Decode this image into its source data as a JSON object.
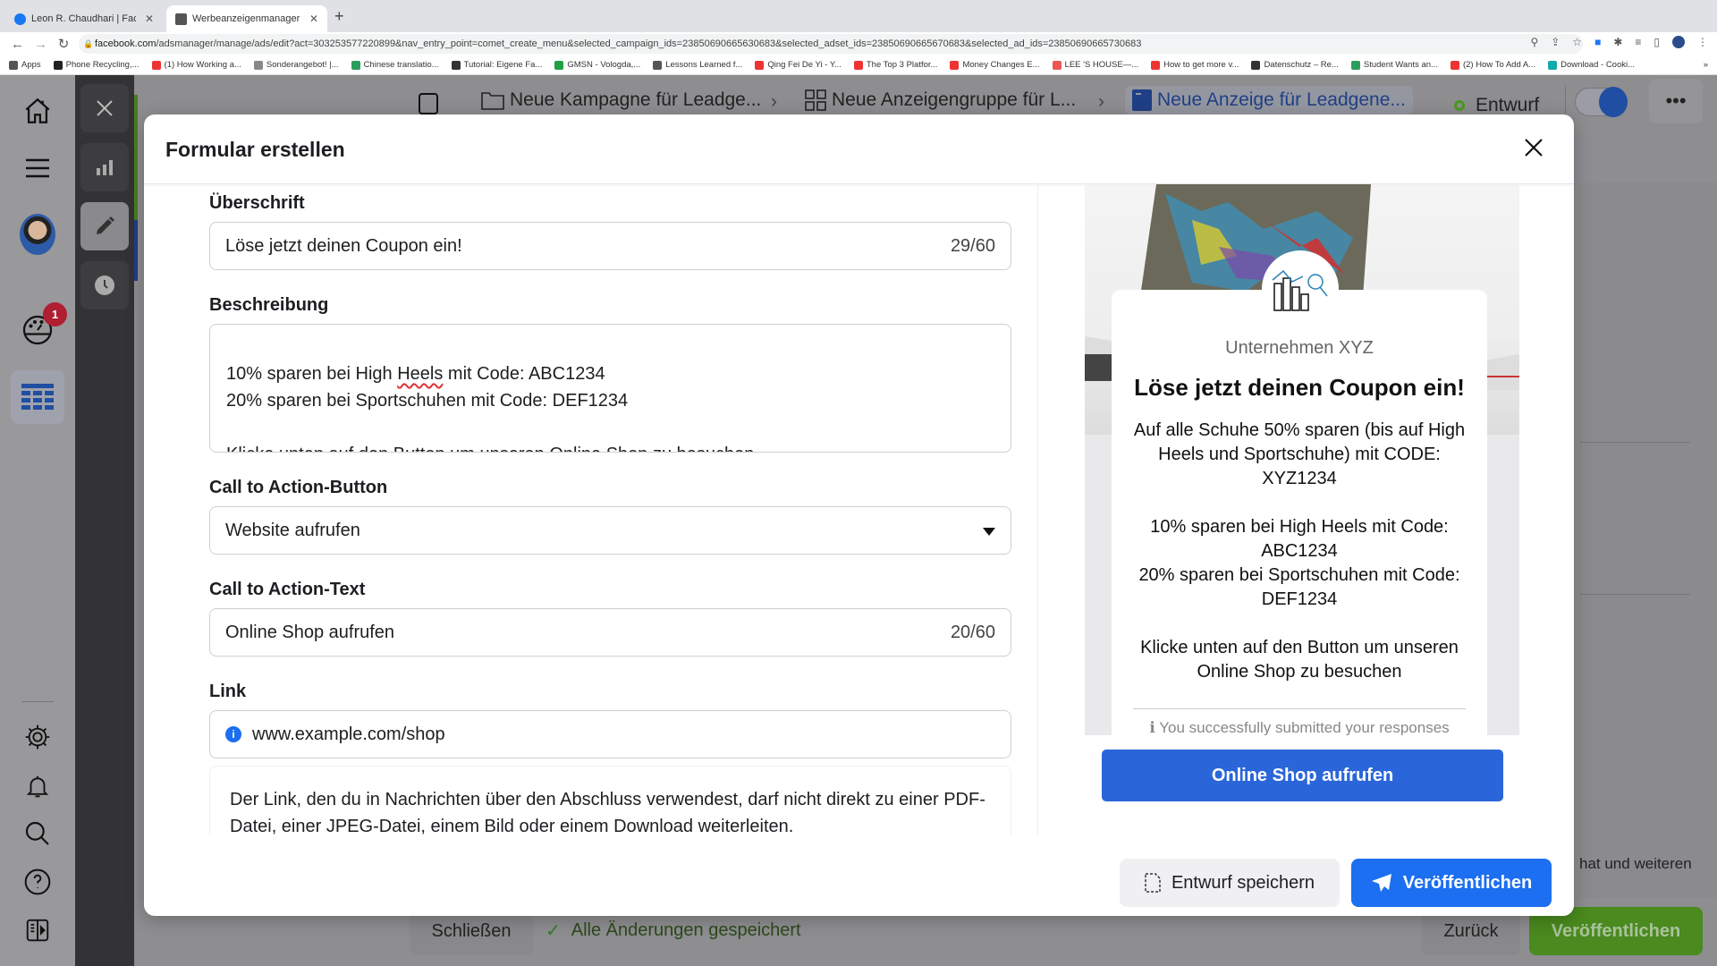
{
  "browser": {
    "tabs": [
      {
        "title": "Leon R. Chaudhari | Facebook",
        "active": false
      },
      {
        "title": "Werbeanzeigenmanager - Wer",
        "active": true
      }
    ],
    "url_host": "facebook.com",
    "url_path": "/adsmanager/manage/ads/edit?act=303253577220899&nav_entry_point=comet_create_menu&selected_campaign_ids=23850690665630683&selected_adset_ids=23850690665670683&selected_ad_ids=23850690665730683",
    "bookmarks": [
      "Apps",
      "Phone Recycling,...",
      "(1) How Working a...",
      "Sonderangebot! |...",
      "Chinese translatio...",
      "Tutorial: Eigene Fa...",
      "GMSN - Vologda,...",
      "Lessons Learned f...",
      "Qing Fei De Yi - Y...",
      "The Top 3 Platfor...",
      "Money Changes E...",
      "LEE 'S HOUSE—...",
      "How to get more v...",
      "Datenschutz – Re...",
      "Student Wants an...",
      "(2) How To Add A...",
      "Download - Cooki..."
    ],
    "more_bookmarks": "»"
  },
  "app": {
    "breadcrumbs": [
      {
        "label": "Neue Kampagne für Leadge...",
        "icon": "folder-icon"
      },
      {
        "label": "Neue Anzeigengruppe für L...",
        "icon": "grid-icon"
      },
      {
        "label": "Neue Anzeige für Leadgene...",
        "icon": "ad-icon"
      }
    ],
    "status": "Entwurf",
    "notification_count": "1",
    "bottom": {
      "close_label": "Schließen",
      "saved_status": "Alle Änderungen gespeichert",
      "back_label": "Zurück",
      "publish_label": "Veröffentlichen"
    },
    "right_partial_text": "hat und weiteren"
  },
  "modal": {
    "title": "Formular erstellen",
    "fields": {
      "headline_label": "Überschrift",
      "headline_value": "Löse jetzt deinen Coupon ein!",
      "headline_count": "29/60",
      "description_label": "Beschreibung",
      "description_lines": [
        "",
        "10% sparen bei High ",
        "Heels",
        " mit Code: ABC1234",
        "20% sparen bei Sportschuhen mit Code: DEF1234",
        "",
        "Klicke unten auf den Button um unseren Online Shop zu besuchen"
      ],
      "cta_button_label": "Call to Action-Button",
      "cta_button_value": "Website aufrufen",
      "cta_text_label": "Call to Action-Text",
      "cta_text_value": "Online Shop aufrufen",
      "cta_text_count": "20/60",
      "link_label": "Link",
      "link_value": "www.example.com/shop",
      "link_notice": "Der Link, den du in Nachrichten über den Abschluss verwendest, darf nicht direkt zu einer PDF-Datei, einer JPEG-Datei, einem Bild oder einem Download weiterleiten."
    },
    "preview": {
      "company": "Unternehmen XYZ",
      "title": "Löse jetzt deinen Coupon ein!",
      "body": "Auf alle Schuhe 50% sparen (bis auf High Heels und Sportschuhe) mit CODE: XYZ1234\n\n10% sparen bei High Heels mit Code: ABC1234\n20% sparen bei Sportschuhen mit Code: DEF1234\n\nKlicke unten auf den Button um unseren Online Shop zu besuchen",
      "submitted_text": "You successfully submitted your responses",
      "cta": "Online Shop aufrufen"
    },
    "footer": {
      "save_draft": "Entwurf speichern",
      "publish": "Veröffentlichen"
    }
  },
  "colors": {
    "primary_blue": "#1b6ff0",
    "preview_cta_blue": "#2a66d9",
    "badge_red": "#b01e32",
    "status_green": "#4a9a1e",
    "publish_green": "#4a8a1e"
  }
}
